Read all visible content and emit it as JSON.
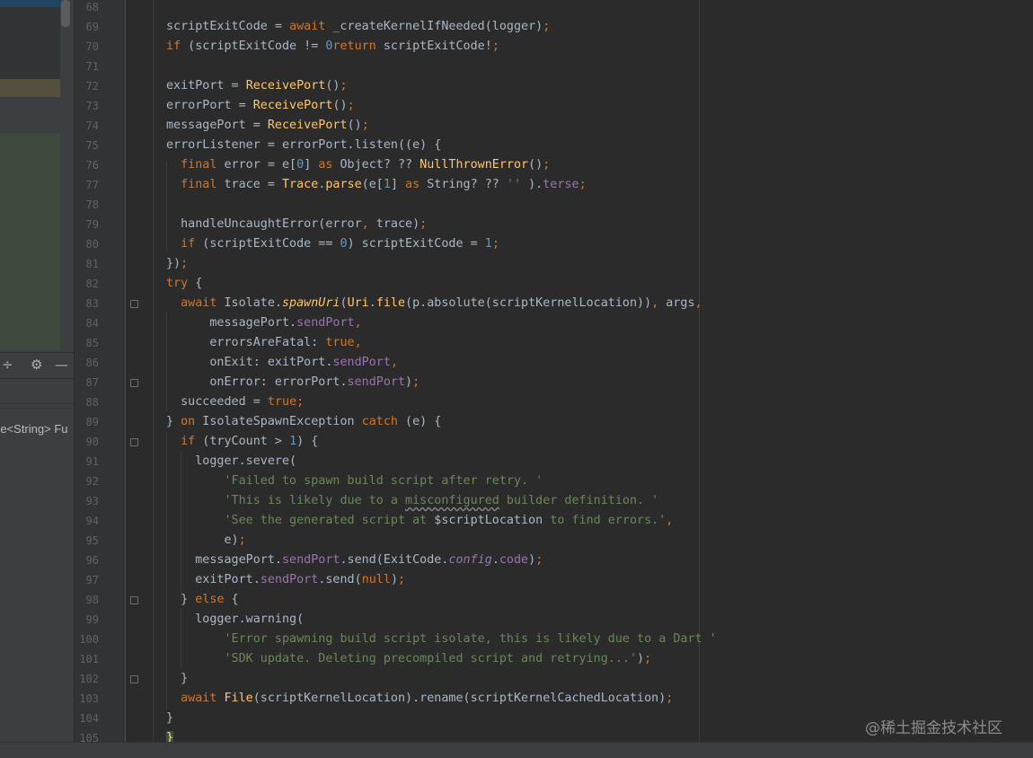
{
  "editor": {
    "lines": [
      {
        "n": "68",
        "fold": false,
        "segs": []
      },
      {
        "n": "69",
        "fold": false,
        "segs": [
          [
            "",
            "scriptExitCode = "
          ],
          [
            "kw",
            "await"
          ],
          [
            "",
            " _createKernelIfNeeded(logger)"
          ],
          [
            "kw",
            ";"
          ]
        ]
      },
      {
        "n": "70",
        "fold": false,
        "segs": [
          [
            "kw",
            "if"
          ],
          [
            "",
            " (scriptExitCode != "
          ],
          [
            "nu",
            "0"
          ],
          [
            ") "
          ],
          [
            "kw",
            "return"
          ],
          [
            "",
            " scriptExitCode!"
          ],
          [
            "kw",
            ";"
          ]
        ]
      },
      {
        "n": "71",
        "fold": false,
        "segs": []
      },
      {
        "n": "72",
        "fold": false,
        "segs": [
          [
            "",
            "exitPort = "
          ],
          [
            "fn",
            "ReceivePort"
          ],
          [
            "",
            "()"
          ],
          [
            "kw",
            ";"
          ]
        ]
      },
      {
        "n": "73",
        "fold": false,
        "segs": [
          [
            "",
            "errorPort = "
          ],
          [
            "fn",
            "ReceivePort"
          ],
          [
            "",
            "()"
          ],
          [
            "kw",
            ";"
          ]
        ]
      },
      {
        "n": "74",
        "fold": false,
        "segs": [
          [
            "",
            "messagePort = "
          ],
          [
            "fn",
            "ReceivePort"
          ],
          [
            "",
            "()"
          ],
          [
            "kw",
            ";"
          ]
        ]
      },
      {
        "n": "75",
        "fold": false,
        "segs": [
          [
            "",
            "errorListener = errorPort.listen((e) {"
          ]
        ]
      },
      {
        "n": "76",
        "fold": false,
        "segs": [
          [
            "",
            "  "
          ],
          [
            "kw",
            "final"
          ],
          [
            "",
            " error = e["
          ],
          [
            "nu",
            "0"
          ],
          [
            "",
            "] "
          ],
          [
            "kw",
            "as"
          ],
          [
            "",
            " Object? ?? "
          ],
          [
            "fn",
            "NullThrownError"
          ],
          [
            "",
            "()"
          ],
          [
            "kw",
            ";"
          ]
        ]
      },
      {
        "n": "77",
        "fold": false,
        "segs": [
          [
            "",
            "  "
          ],
          [
            "kw",
            "final"
          ],
          [
            "",
            " trace = "
          ],
          [
            "fn",
            "Trace"
          ],
          [
            "",
            "."
          ],
          [
            "fn",
            "parse"
          ],
          [
            "",
            "(e["
          ],
          [
            "nu",
            "1"
          ],
          [
            "",
            "] "
          ],
          [
            "kw",
            "as"
          ],
          [
            "",
            " String? ?? "
          ],
          [
            "st",
            "''"
          ],
          [
            "",
            " )."
          ],
          [
            "pr",
            "terse"
          ],
          [
            "kw",
            ";"
          ]
        ]
      },
      {
        "n": "78",
        "fold": false,
        "segs": []
      },
      {
        "n": "79",
        "fold": false,
        "segs": [
          [
            "",
            "  handleUncaughtError(error"
          ],
          [
            "kw",
            ","
          ],
          [
            "",
            " trace)"
          ],
          [
            "kw",
            ";"
          ]
        ]
      },
      {
        "n": "80",
        "fold": false,
        "segs": [
          [
            "",
            "  "
          ],
          [
            "kw",
            "if"
          ],
          [
            "",
            " (scriptExitCode == "
          ],
          [
            "nu",
            "0"
          ],
          [
            "",
            ") scriptExitCode = "
          ],
          [
            "nu",
            "1"
          ],
          [
            "kw",
            ";"
          ]
        ]
      },
      {
        "n": "81",
        "fold": false,
        "segs": [
          [
            "",
            "})"
          ],
          [
            "kw",
            ";"
          ]
        ]
      },
      {
        "n": "82",
        "fold": false,
        "segs": [
          [
            "kw",
            "try"
          ],
          [
            "",
            " {"
          ]
        ]
      },
      {
        "n": "83",
        "fold": true,
        "segs": [
          [
            "",
            "  "
          ],
          [
            "kw",
            "await"
          ],
          [
            "",
            " Isolate."
          ],
          [
            "fi",
            "spawnUri"
          ],
          [
            "",
            "("
          ],
          [
            "fn",
            "Uri"
          ],
          [
            "",
            "."
          ],
          [
            "fn",
            "file"
          ],
          [
            "",
            "(p.absolute(scriptKernelLocation))"
          ],
          [
            "kw",
            ","
          ],
          [
            "",
            " args"
          ],
          [
            "kw",
            ","
          ]
        ]
      },
      {
        "n": "84",
        "fold": false,
        "segs": [
          [
            "",
            "      messagePort."
          ],
          [
            "pr",
            "sendPort"
          ],
          [
            "kw",
            ","
          ]
        ]
      },
      {
        "n": "85",
        "fold": false,
        "segs": [
          [
            "",
            "      errorsAreFatal: "
          ],
          [
            "kw",
            "true"
          ],
          [
            "kw",
            ","
          ]
        ]
      },
      {
        "n": "86",
        "fold": false,
        "segs": [
          [
            "",
            "      onExit: exitPort."
          ],
          [
            "pr",
            "sendPort"
          ],
          [
            "kw",
            ","
          ]
        ]
      },
      {
        "n": "87",
        "fold": true,
        "segs": [
          [
            "",
            "      onError: errorPort."
          ],
          [
            "pr",
            "sendPort"
          ],
          [
            "",
            ")"
          ],
          [
            "kw",
            ";"
          ]
        ]
      },
      {
        "n": "88",
        "fold": false,
        "segs": [
          [
            "",
            "  succeeded = "
          ],
          [
            "kw",
            "true"
          ],
          [
            "kw",
            ";"
          ]
        ]
      },
      {
        "n": "89",
        "fold": false,
        "segs": [
          [
            "",
            "} "
          ],
          [
            "kw",
            "on"
          ],
          [
            "",
            " IsolateSpawnException "
          ],
          [
            "kw",
            "catch"
          ],
          [
            "",
            " (e) {"
          ]
        ]
      },
      {
        "n": "90",
        "fold": true,
        "segs": [
          [
            "",
            "  "
          ],
          [
            "kw",
            "if"
          ],
          [
            "",
            " (tryCount > "
          ],
          [
            "nu",
            "1"
          ],
          [
            "",
            ") {"
          ]
        ]
      },
      {
        "n": "91",
        "fold": false,
        "segs": [
          [
            "",
            "    logger.severe("
          ]
        ]
      },
      {
        "n": "92",
        "fold": false,
        "segs": [
          [
            "",
            "        "
          ],
          [
            "st",
            "'Failed to spawn build script after retry. '"
          ]
        ]
      },
      {
        "n": "93",
        "fold": false,
        "segs": [
          [
            "",
            "        "
          ],
          [
            "st",
            "'This is likely due to a "
          ],
          [
            "st wv",
            "misconfigured"
          ],
          [
            "st",
            " builder definition. '"
          ]
        ]
      },
      {
        "n": "94",
        "fold": false,
        "segs": [
          [
            "",
            "        "
          ],
          [
            "st",
            "'See the generated script at "
          ],
          [
            "",
            "$scriptLocation"
          ],
          [
            "st",
            " to find errors.'"
          ],
          [
            "kw",
            ","
          ]
        ]
      },
      {
        "n": "95",
        "fold": false,
        "segs": [
          [
            "",
            "        e)"
          ],
          [
            "kw",
            ";"
          ]
        ]
      },
      {
        "n": "96",
        "fold": false,
        "segs": [
          [
            "",
            "    messagePort."
          ],
          [
            "pr",
            "sendPort"
          ],
          [
            "",
            ".send(ExitCode."
          ],
          [
            "pi",
            "config"
          ],
          [
            "",
            "."
          ],
          [
            "pr",
            "code"
          ],
          [
            "",
            ")"
          ],
          [
            "kw",
            ";"
          ]
        ]
      },
      {
        "n": "97",
        "fold": false,
        "segs": [
          [
            "",
            "    exitPort."
          ],
          [
            "pr",
            "sendPort"
          ],
          [
            "",
            ".send("
          ],
          [
            "kw",
            "null"
          ],
          [
            "",
            ")"
          ],
          [
            "kw",
            ";"
          ]
        ]
      },
      {
        "n": "98",
        "fold": true,
        "segs": [
          [
            "",
            "  } "
          ],
          [
            "kw",
            "else"
          ],
          [
            "",
            " {"
          ]
        ]
      },
      {
        "n": "99",
        "fold": false,
        "segs": [
          [
            "",
            "    logger.warning("
          ]
        ]
      },
      {
        "n": "100",
        "fold": false,
        "segs": [
          [
            "",
            "        "
          ],
          [
            "st",
            "'Error spawning build script isolate, this is likely due to a Dart '"
          ]
        ]
      },
      {
        "n": "101",
        "fold": false,
        "segs": [
          [
            "",
            "        "
          ],
          [
            "st",
            "'SDK update. Deleting precompiled script and retrying...'"
          ],
          [
            "",
            ")"
          ],
          [
            "kw",
            ";"
          ]
        ]
      },
      {
        "n": "102",
        "fold": true,
        "segs": [
          [
            "",
            "  }"
          ]
        ]
      },
      {
        "n": "103",
        "fold": false,
        "segs": [
          [
            "",
            "  "
          ],
          [
            "kw",
            "await"
          ],
          [
            "",
            " "
          ],
          [
            "fn",
            "File"
          ],
          [
            "",
            "(scriptKernelLocation).rename(scriptKernelCachedLocation)"
          ],
          [
            "kw",
            ";"
          ]
        ]
      },
      {
        "n": "104",
        "fold": false,
        "segs": [
          [
            "",
            "}"
          ]
        ]
      },
      {
        "n": "105",
        "fold": false,
        "segs": [
          [
            "caret",
            "}"
          ]
        ]
      }
    ]
  },
  "left_panel": {
    "toolbar_icons": [
      "split-icon",
      "gear-icon",
      "minimize-icon"
    ],
    "partial_text": "re<String> Fu"
  },
  "colors": {
    "background": "#2b2b2b",
    "keyword": "#cc7832",
    "function": "#ffc66d",
    "number": "#6897bb",
    "string": "#6a8759",
    "property": "#9876aa",
    "text": "#a9b7c6"
  },
  "watermark": "@稀土掘金技术社区"
}
